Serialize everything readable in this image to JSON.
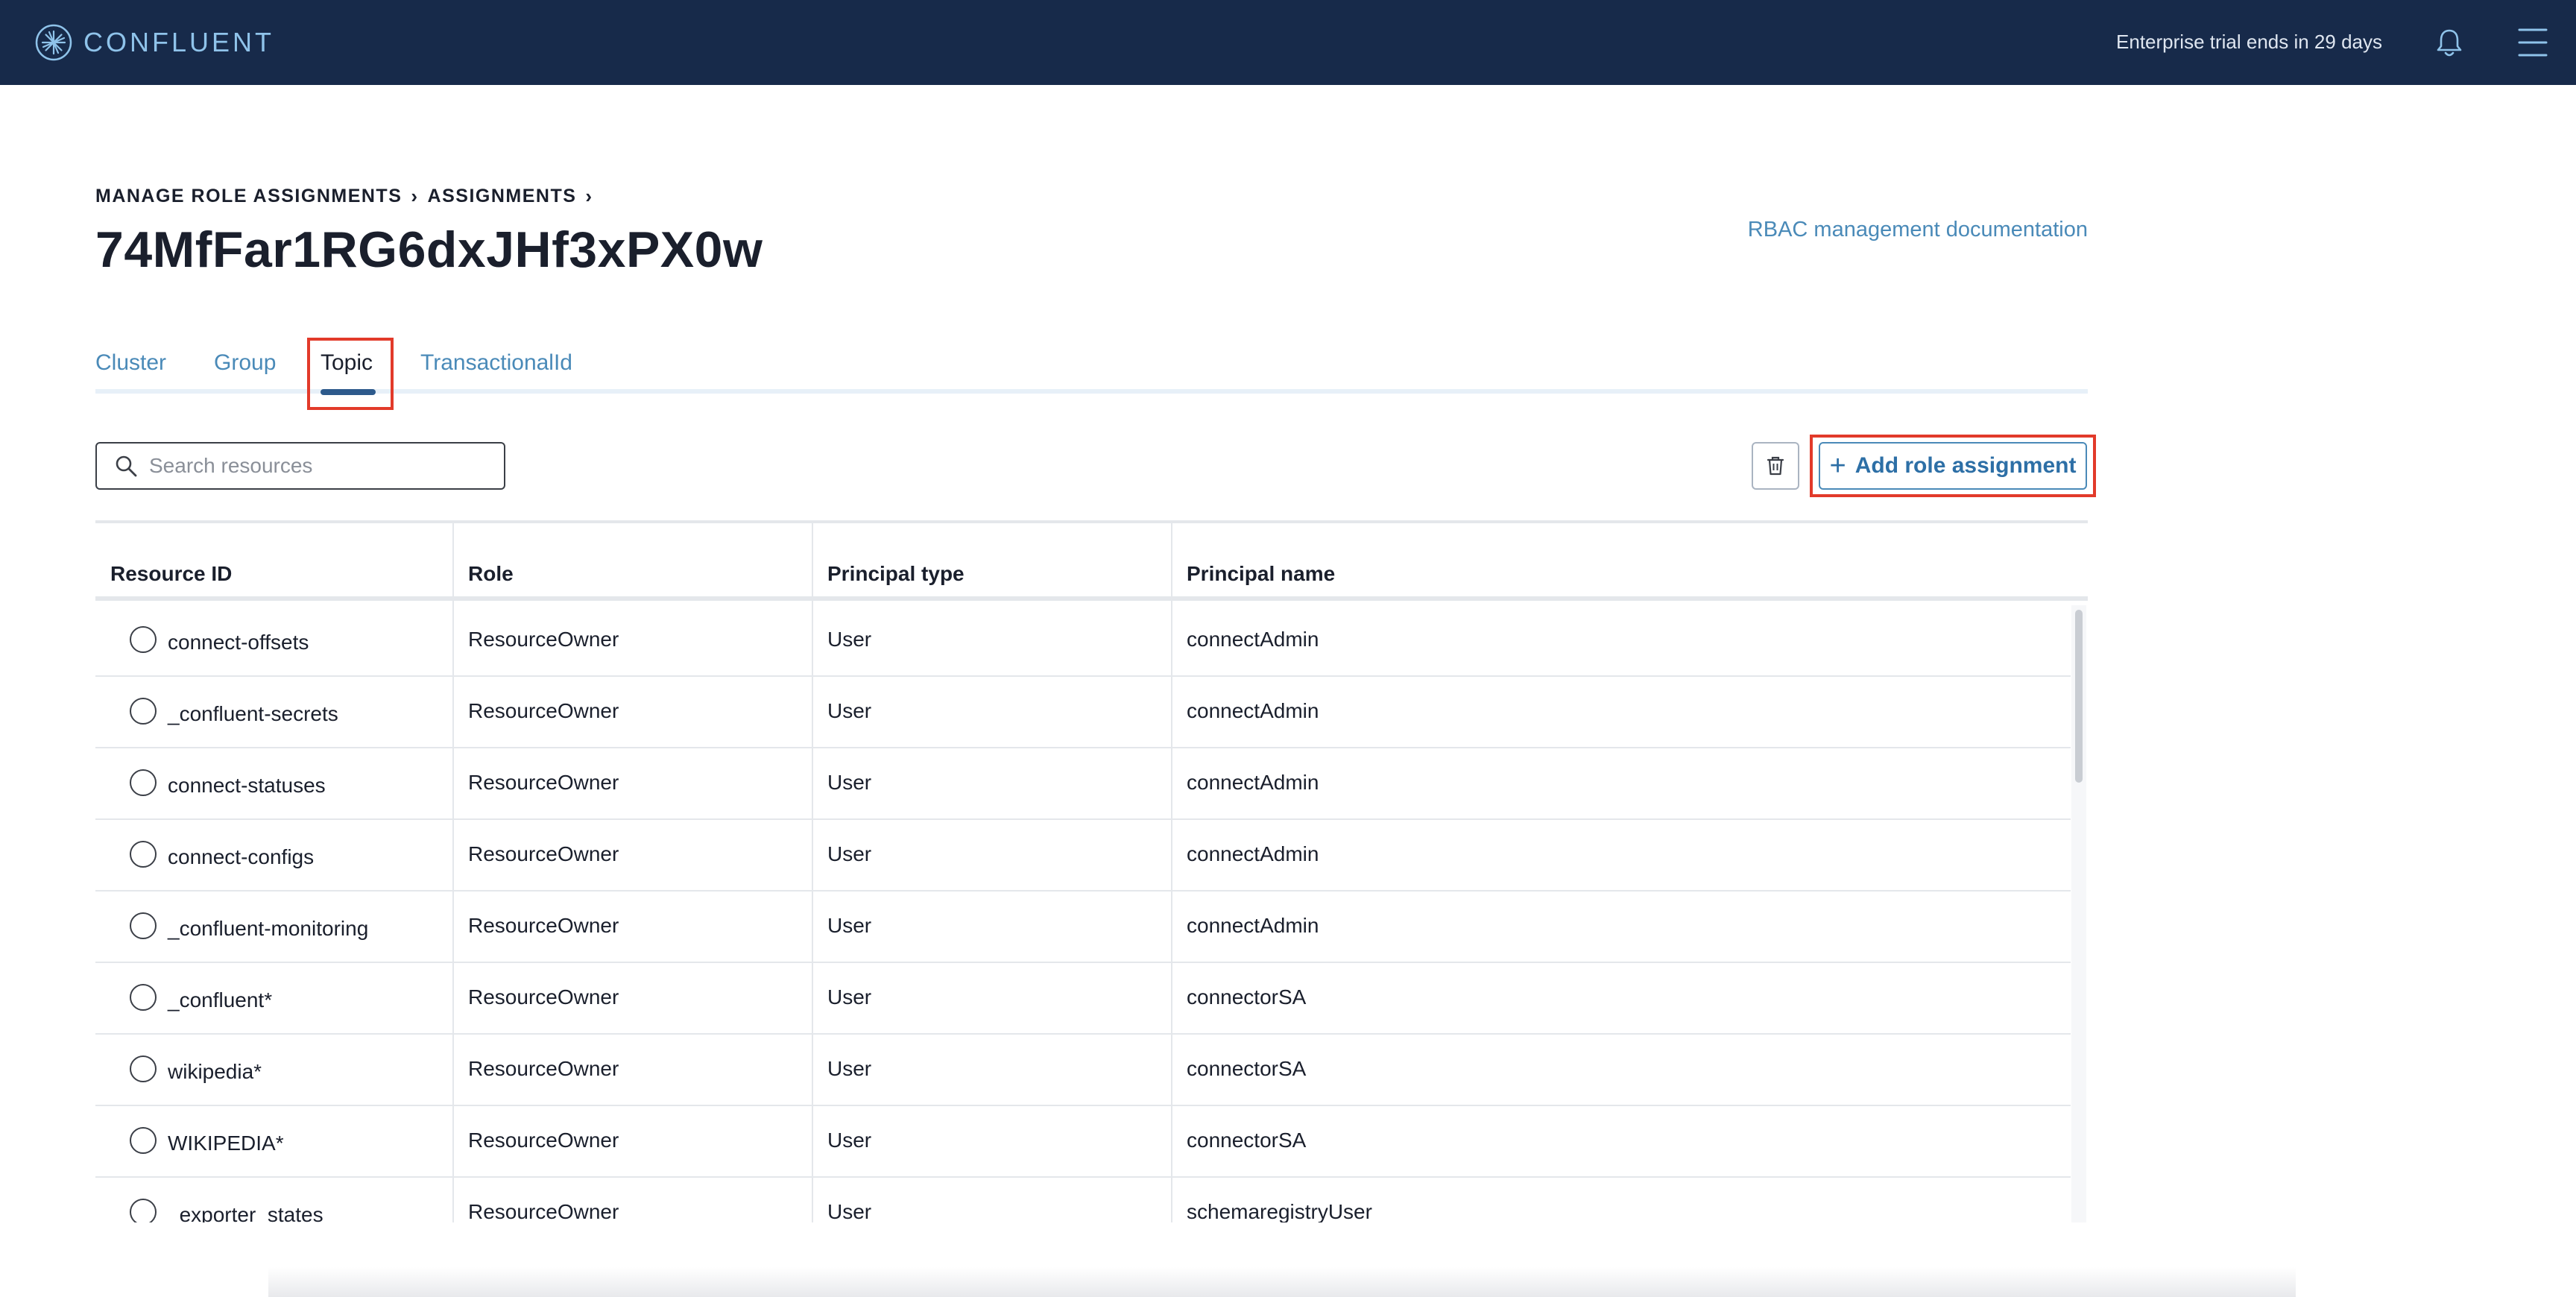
{
  "header": {
    "logo_text": "CONFLUENT",
    "trial_text": "Enterprise trial ends in 29 days"
  },
  "breadcrumb": [
    "MANAGE ROLE ASSIGNMENTS",
    "ASSIGNMENTS"
  ],
  "page_title": "74MfFar1RG6dxJHf3xPX0w",
  "doc_link": "RBAC management documentation",
  "tabs": [
    {
      "label": "Cluster",
      "active": false
    },
    {
      "label": "Group",
      "active": false
    },
    {
      "label": "Topic",
      "active": true
    },
    {
      "label": "TransactionalId",
      "active": false
    }
  ],
  "search": {
    "placeholder": "Search resources"
  },
  "toolbar": {
    "add_label": "Add role assignment"
  },
  "table": {
    "columns": [
      "Resource ID",
      "Role",
      "Principal type",
      "Principal name"
    ],
    "rows": [
      {
        "resource": "connect-offsets",
        "role": "ResourceOwner",
        "type": "User",
        "principal": "connectAdmin"
      },
      {
        "resource": "_confluent-secrets",
        "role": "ResourceOwner",
        "type": "User",
        "principal": "connectAdmin"
      },
      {
        "resource": "connect-statuses",
        "role": "ResourceOwner",
        "type": "User",
        "principal": "connectAdmin"
      },
      {
        "resource": "connect-configs",
        "role": "ResourceOwner",
        "type": "User",
        "principal": "connectAdmin"
      },
      {
        "resource": "_confluent-monitoring",
        "role": "ResourceOwner",
        "type": "User",
        "principal": "connectAdmin"
      },
      {
        "resource": "_confluent*",
        "role": "ResourceOwner",
        "type": "User",
        "principal": "connectorSA"
      },
      {
        "resource": "wikipedia*",
        "role": "ResourceOwner",
        "type": "User",
        "principal": "connectorSA"
      },
      {
        "resource": "WIKIPEDIA*",
        "role": "ResourceOwner",
        "type": "User",
        "principal": "connectorSA"
      },
      {
        "resource": "_exporter_states",
        "role": "ResourceOwner",
        "type": "User",
        "principal": "schemaregistryUser"
      }
    ]
  },
  "colors": {
    "topbar": "#172a4a",
    "link": "#4a8ab8",
    "highlight": "#e23a2a"
  }
}
